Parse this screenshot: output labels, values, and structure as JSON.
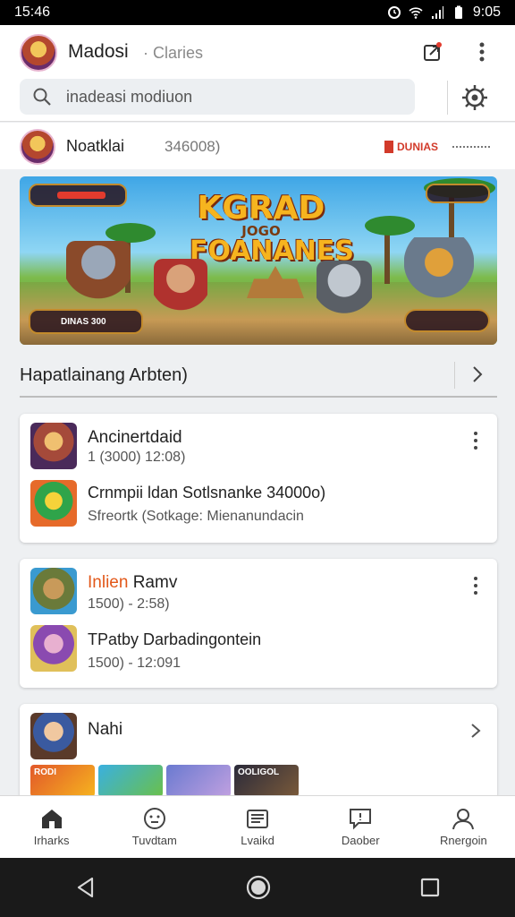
{
  "status_bar": {
    "time": "15:46",
    "clock_right": "9:05"
  },
  "header": {
    "title": "Madosi",
    "subtitle": "· Claries",
    "search_placeholder": "inadeasi modiuon"
  },
  "channel": {
    "name": "Noatklai",
    "count": "346008)",
    "badge": "DUNIAS"
  },
  "banner": {
    "title_line1": "KGRAD",
    "title_line2": "JOGO",
    "title_line3": "FOANANES",
    "hud_top": "",
    "hud_bottom": "DINAS 300"
  },
  "section": {
    "title": "Hapatlainang Arbten)"
  },
  "cards": [
    {
      "title": "Ancinertdaid",
      "sub": "1 (3000) 12:08)",
      "title2": "Crnmpii ldan Sotlsnanke 34000o)",
      "sub2": "Sfreortk (Sotkage: Mienanundacin"
    },
    {
      "title_prefix": "Inlien",
      "title_rest": " Ramv",
      "sub": "1500) - 2:58)",
      "title2": "TPatby Darbadingontein",
      "sub2": "1500) - 12:091"
    },
    {
      "title": "Nahi",
      "tiles": [
        "RODI",
        "",
        "",
        "OOLIGOL"
      ]
    }
  ],
  "bottom_nav": [
    {
      "label": "Irharks",
      "icon": "home-icon"
    },
    {
      "label": "Tuvdtam",
      "icon": "smiley-icon"
    },
    {
      "label": "Lvaikd",
      "icon": "library-icon"
    },
    {
      "label": "Daober",
      "icon": "message-icon"
    },
    {
      "label": "Rnergoin",
      "icon": "profile-icon"
    }
  ],
  "colors": {
    "accent": "#e2581a",
    "badge": "#d23a2a",
    "banner_title": "#f6b41f"
  }
}
